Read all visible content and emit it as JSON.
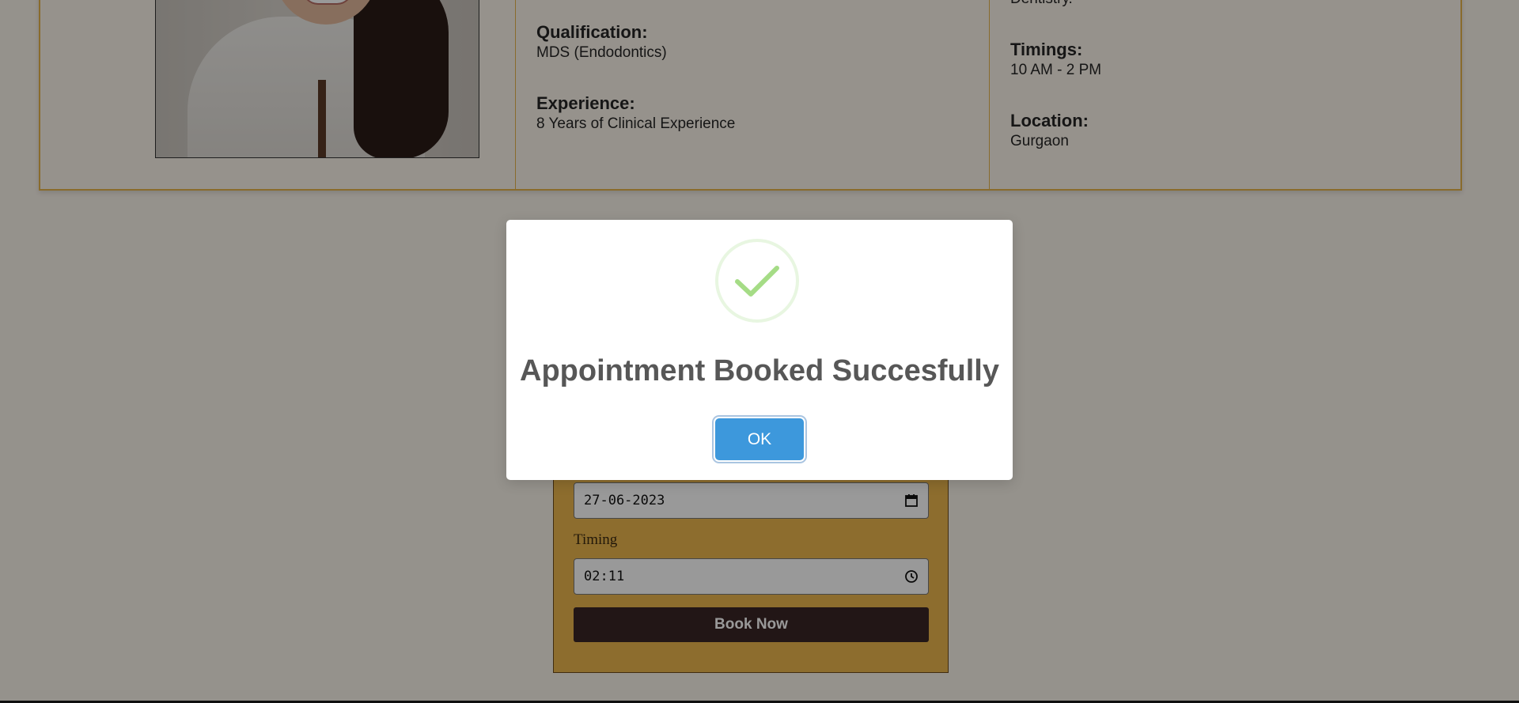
{
  "doctor": {
    "specialty_tail": "Dentistry.",
    "qualification_label": "Qualification:",
    "qualification_value": "MDS (Endodontics)",
    "experience_label": "Experience:",
    "experience_value": "8 Years of Clinical Experience",
    "timings_label": "Timings:",
    "timings_value": "10 AM - 2 PM",
    "location_label": "Location:",
    "location_value": "Gurgaon"
  },
  "booking": {
    "date_value": "27-06-2023",
    "timing_label": "Timing",
    "time_value": "02:11",
    "book_button": "Book Now"
  },
  "modal": {
    "title": "Appointment Booked Succesfully",
    "ok_label": "OK",
    "icon": "checkmark-icon"
  },
  "colors": {
    "accent_gold": "#e4b24a",
    "success_green": "#a5dc86",
    "ok_blue": "#3d98dc",
    "book_button_bg": "#3a2525"
  }
}
